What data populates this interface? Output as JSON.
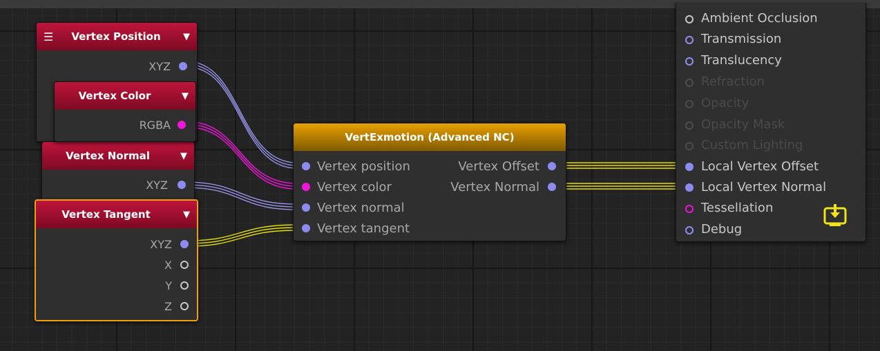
{
  "colors": {
    "vector": "#8b8bf0",
    "color": "#ee16d9",
    "yellow_wire": "#e8e000",
    "selected": "#f0a000"
  },
  "nodes": {
    "vertex_position": {
      "title": "Vertex Position",
      "ports": [
        "XYZ"
      ]
    },
    "vertex_color": {
      "title": "Vertex Color",
      "ports": [
        "RGBA"
      ]
    },
    "vertex_normal": {
      "title": "Vertex Normal",
      "ports": [
        "XYZ"
      ]
    },
    "vertex_tangent": {
      "title": "Vertex Tangent",
      "ports": [
        "XYZ",
        "X",
        "Y",
        "Z"
      ]
    }
  },
  "vertexmotion": {
    "title": "VertExmotion (Advanced NC)",
    "inputs": [
      "Vertex position",
      "Vertex color",
      "Vertex normal",
      "Vertex tangent"
    ],
    "outputs": [
      "Vertex Offset",
      "Vertex Normal"
    ]
  },
  "output_node": {
    "inputs": [
      "Ambient Occlusion",
      "Transmission",
      "Translucency",
      "Refraction",
      "Opacity",
      "Opacity Mask",
      "Custom Lighting",
      "Local Vertex Offset",
      "Local Vertex Normal",
      "Tessellation",
      "Debug"
    ],
    "icon": "export-icon"
  },
  "icons": {
    "menu": "hamburger-icon",
    "arrow": "dropdown-arrow-icon"
  }
}
